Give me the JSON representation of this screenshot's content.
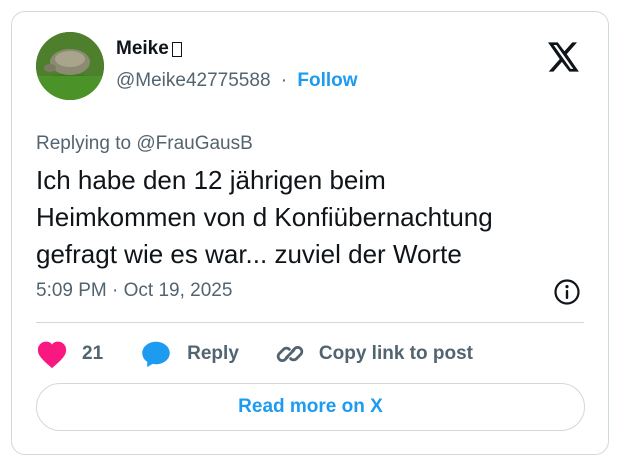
{
  "author": {
    "display_name": "Meike",
    "handle": "@Meike42775588",
    "separator": "·",
    "follow_label": "Follow"
  },
  "reply_context": {
    "prefix": "Replying to",
    "mention": "@FrauGausB"
  },
  "tweet": {
    "text": "Ich habe den 12 jährigen beim\nHeimkommen von d Konfiübernachtung\ngefragt wie es war... zuviel der Worte",
    "timestamp": "5:09 PM · Oct 19, 2025"
  },
  "actions": {
    "like_count": "21",
    "reply_label": "Reply",
    "copy_label": "Copy link to post"
  },
  "read_more_label": "Read more on X",
  "colors": {
    "accent": "#1d9bf0",
    "like": "#f91880",
    "text": "#0f1419",
    "muted": "#536471",
    "border": "#cfd9de"
  },
  "icons": [
    "x-logo-icon",
    "info-icon",
    "heart-icon",
    "speech-bubble-icon",
    "link-icon"
  ]
}
